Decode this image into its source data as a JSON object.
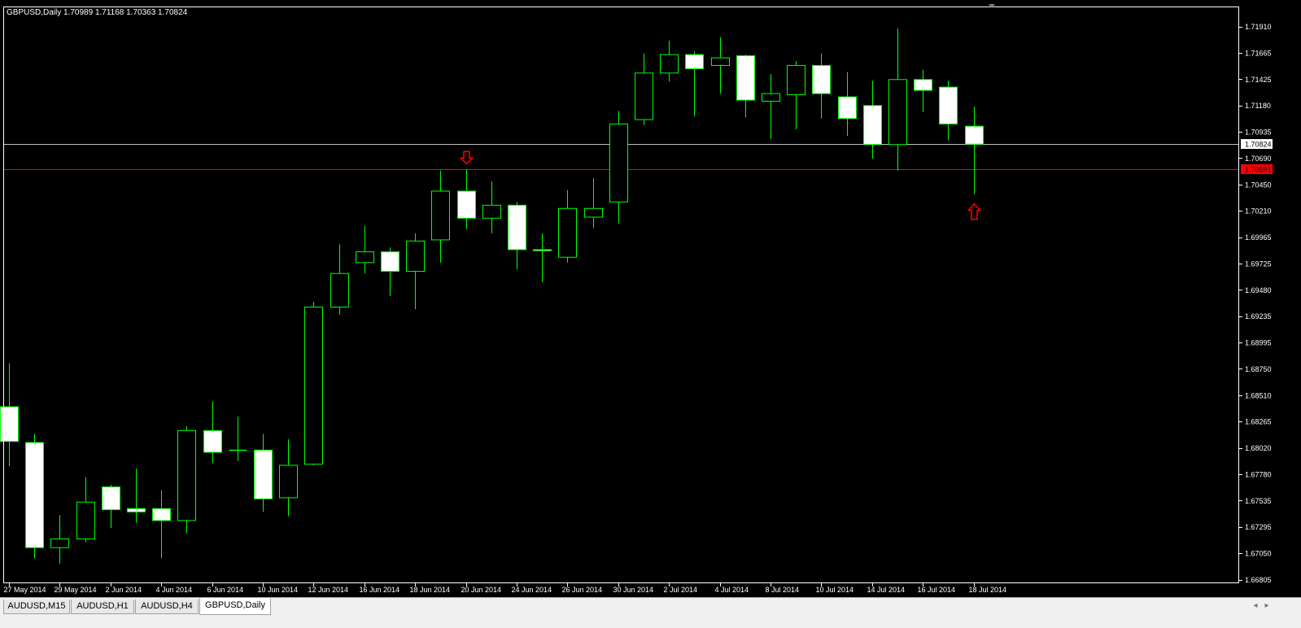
{
  "window": {
    "header_text": "GBPUSD,Daily  1.70989 1.71168 1.70363 1.70824"
  },
  "chart": {
    "symbol": "GBPUSD",
    "timeframe": "Daily",
    "ohlc": {
      "open": "1.70989",
      "high": "1.71168",
      "low": "1.70363",
      "close": "1.70824"
    },
    "colors": {
      "background": "#000000",
      "candle_outline": "#00ff00",
      "bull_body": "#000000",
      "bear_body": "#ffffff",
      "price_line": "#c0c0c0",
      "horizontal_line": "#ff0000",
      "arrow": "#ff0000",
      "axis": "#ffffff"
    },
    "price_axis_labels": [
      "1.71910",
      "1.71665",
      "1.71425",
      "1.71180",
      "1.70935",
      "1.70690",
      "1.70450",
      "1.70210",
      "1.69965",
      "1.69725",
      "1.69480",
      "1.69235",
      "1.68995",
      "1.68750",
      "1.68510",
      "1.68265",
      "1.68020",
      "1.67780",
      "1.67535",
      "1.67295",
      "1.67050",
      "1.66805"
    ],
    "current_price_label": "1.70824",
    "red_line_label": "1.70591",
    "time_axis_labels": [
      "27 May 2014",
      "29 May 2014",
      "2 Jun 2014",
      "4 Jun 2014",
      "6 Jun 2014",
      "10 Jun 2014",
      "12 Jun 2014",
      "16 Jun 2014",
      "18 Jun 2014",
      "20 Jun 2014",
      "24 Jun 2014",
      "26 Jun 2014",
      "30 Jun 2014",
      "2 Jul 2014",
      "4 Jul 2014",
      "8 Jul 2014",
      "10 Jul 2014",
      "14 Jul 2014",
      "16 Jul 2014",
      "18 Jul 2014"
    ],
    "markers": [
      {
        "name": "down-arrow-marker",
        "direction": "down",
        "candle_index": 18
      },
      {
        "name": "up-arrow-marker",
        "direction": "up",
        "candle_index": 38
      }
    ]
  },
  "chart_data": {
    "type": "candlestick",
    "ylim": [
      1.66805,
      1.7191
    ],
    "horizontal_lines": [
      {
        "name": "current-price",
        "value": 1.70824,
        "color": "#c0c0c0"
      },
      {
        "name": "red-level",
        "value": 1.70591,
        "color": "#ff0000"
      }
    ],
    "candles": [
      {
        "o": 1.684,
        "h": 1.688,
        "l": 1.6785,
        "c": 1.6808
      },
      {
        "o": 1.6807,
        "h": 1.6815,
        "l": 1.67,
        "c": 1.671
      },
      {
        "o": 1.671,
        "h": 1.674,
        "l": 1.6695,
        "c": 1.6718
      },
      {
        "o": 1.6718,
        "h": 1.6775,
        "l": 1.6715,
        "c": 1.6752
      },
      {
        "o": 1.6766,
        "h": 1.6768,
        "l": 1.6728,
        "c": 1.6745
      },
      {
        "o": 1.6746,
        "h": 1.6783,
        "l": 1.6733,
        "c": 1.6743
      },
      {
        "o": 1.6746,
        "h": 1.6763,
        "l": 1.67,
        "c": 1.6735
      },
      {
        "o": 1.6735,
        "h": 1.6822,
        "l": 1.6723,
        "c": 1.6818
      },
      {
        "o": 1.6818,
        "h": 1.6845,
        "l": 1.6788,
        "c": 1.6798
      },
      {
        "o": 1.68,
        "h": 1.6831,
        "l": 1.679,
        "c": 1.68
      },
      {
        "o": 1.68,
        "h": 1.6815,
        "l": 1.6743,
        "c": 1.6755
      },
      {
        "o": 1.6756,
        "h": 1.681,
        "l": 1.6739,
        "c": 1.6786
      },
      {
        "o": 1.6787,
        "h": 1.6937,
        "l": 1.6786,
        "c": 1.6932
      },
      {
        "o": 1.6932,
        "h": 1.699,
        "l": 1.6925,
        "c": 1.6963
      },
      {
        "o": 1.6973,
        "h": 1.7007,
        "l": 1.6963,
        "c": 1.6983
      },
      {
        "o": 1.6983,
        "h": 1.6987,
        "l": 1.6942,
        "c": 1.6965
      },
      {
        "o": 1.6965,
        "h": 1.7,
        "l": 1.693,
        "c": 1.6993
      },
      {
        "o": 1.6994,
        "h": 1.7058,
        "l": 1.6973,
        "c": 1.7039
      },
      {
        "o": 1.7039,
        "h": 1.7059,
        "l": 1.7004,
        "c": 1.7014
      },
      {
        "o": 1.7014,
        "h": 1.7048,
        "l": 1.7,
        "c": 1.7026
      },
      {
        "o": 1.7026,
        "h": 1.7029,
        "l": 1.6967,
        "c": 1.6985
      },
      {
        "o": 1.6985,
        "h": 1.7,
        "l": 1.6955,
        "c": 1.6984
      },
      {
        "o": 1.6978,
        "h": 1.704,
        "l": 1.6973,
        "c": 1.7023
      },
      {
        "o": 1.7015,
        "h": 1.7051,
        "l": 1.7005,
        "c": 1.7023
      },
      {
        "o": 1.7029,
        "h": 1.7113,
        "l": 1.7009,
        "c": 1.7101
      },
      {
        "o": 1.7105,
        "h": 1.7166,
        "l": 1.71,
        "c": 1.7148
      },
      {
        "o": 1.7148,
        "h": 1.7178,
        "l": 1.714,
        "c": 1.7165
      },
      {
        "o": 1.7165,
        "h": 1.7168,
        "l": 1.7108,
        "c": 1.7152
      },
      {
        "o": 1.7155,
        "h": 1.7181,
        "l": 1.7129,
        "c": 1.7162
      },
      {
        "o": 1.7164,
        "h": 1.7165,
        "l": 1.7107,
        "c": 1.7123
      },
      {
        "o": 1.7122,
        "h": 1.7147,
        "l": 1.7087,
        "c": 1.7129
      },
      {
        "o": 1.7128,
        "h": 1.7159,
        "l": 1.7096,
        "c": 1.7155
      },
      {
        "o": 1.7155,
        "h": 1.7166,
        "l": 1.7106,
        "c": 1.7129
      },
      {
        "o": 1.7126,
        "h": 1.7149,
        "l": 1.709,
        "c": 1.7106
      },
      {
        "o": 1.7118,
        "h": 1.7141,
        "l": 1.7069,
        "c": 1.7082
      },
      {
        "o": 1.7082,
        "h": 1.7189,
        "l": 1.7058,
        "c": 1.7142
      },
      {
        "o": 1.7142,
        "h": 1.7151,
        "l": 1.7112,
        "c": 1.7132
      },
      {
        "o": 1.7135,
        "h": 1.7141,
        "l": 1.7086,
        "c": 1.7101
      },
      {
        "o": 1.70989,
        "h": 1.71168,
        "l": 1.70363,
        "c": 1.70824
      }
    ]
  },
  "tabs": [
    {
      "label": "AUDUSD,M15",
      "active": false
    },
    {
      "label": "AUDUSD,H1",
      "active": false
    },
    {
      "label": "AUDUSD,H4",
      "active": false
    },
    {
      "label": "GBPUSD,Daily",
      "active": true
    }
  ],
  "scroll": {
    "left_icon": "scroll-left-icon",
    "right_icon": "scroll-right-icon"
  }
}
